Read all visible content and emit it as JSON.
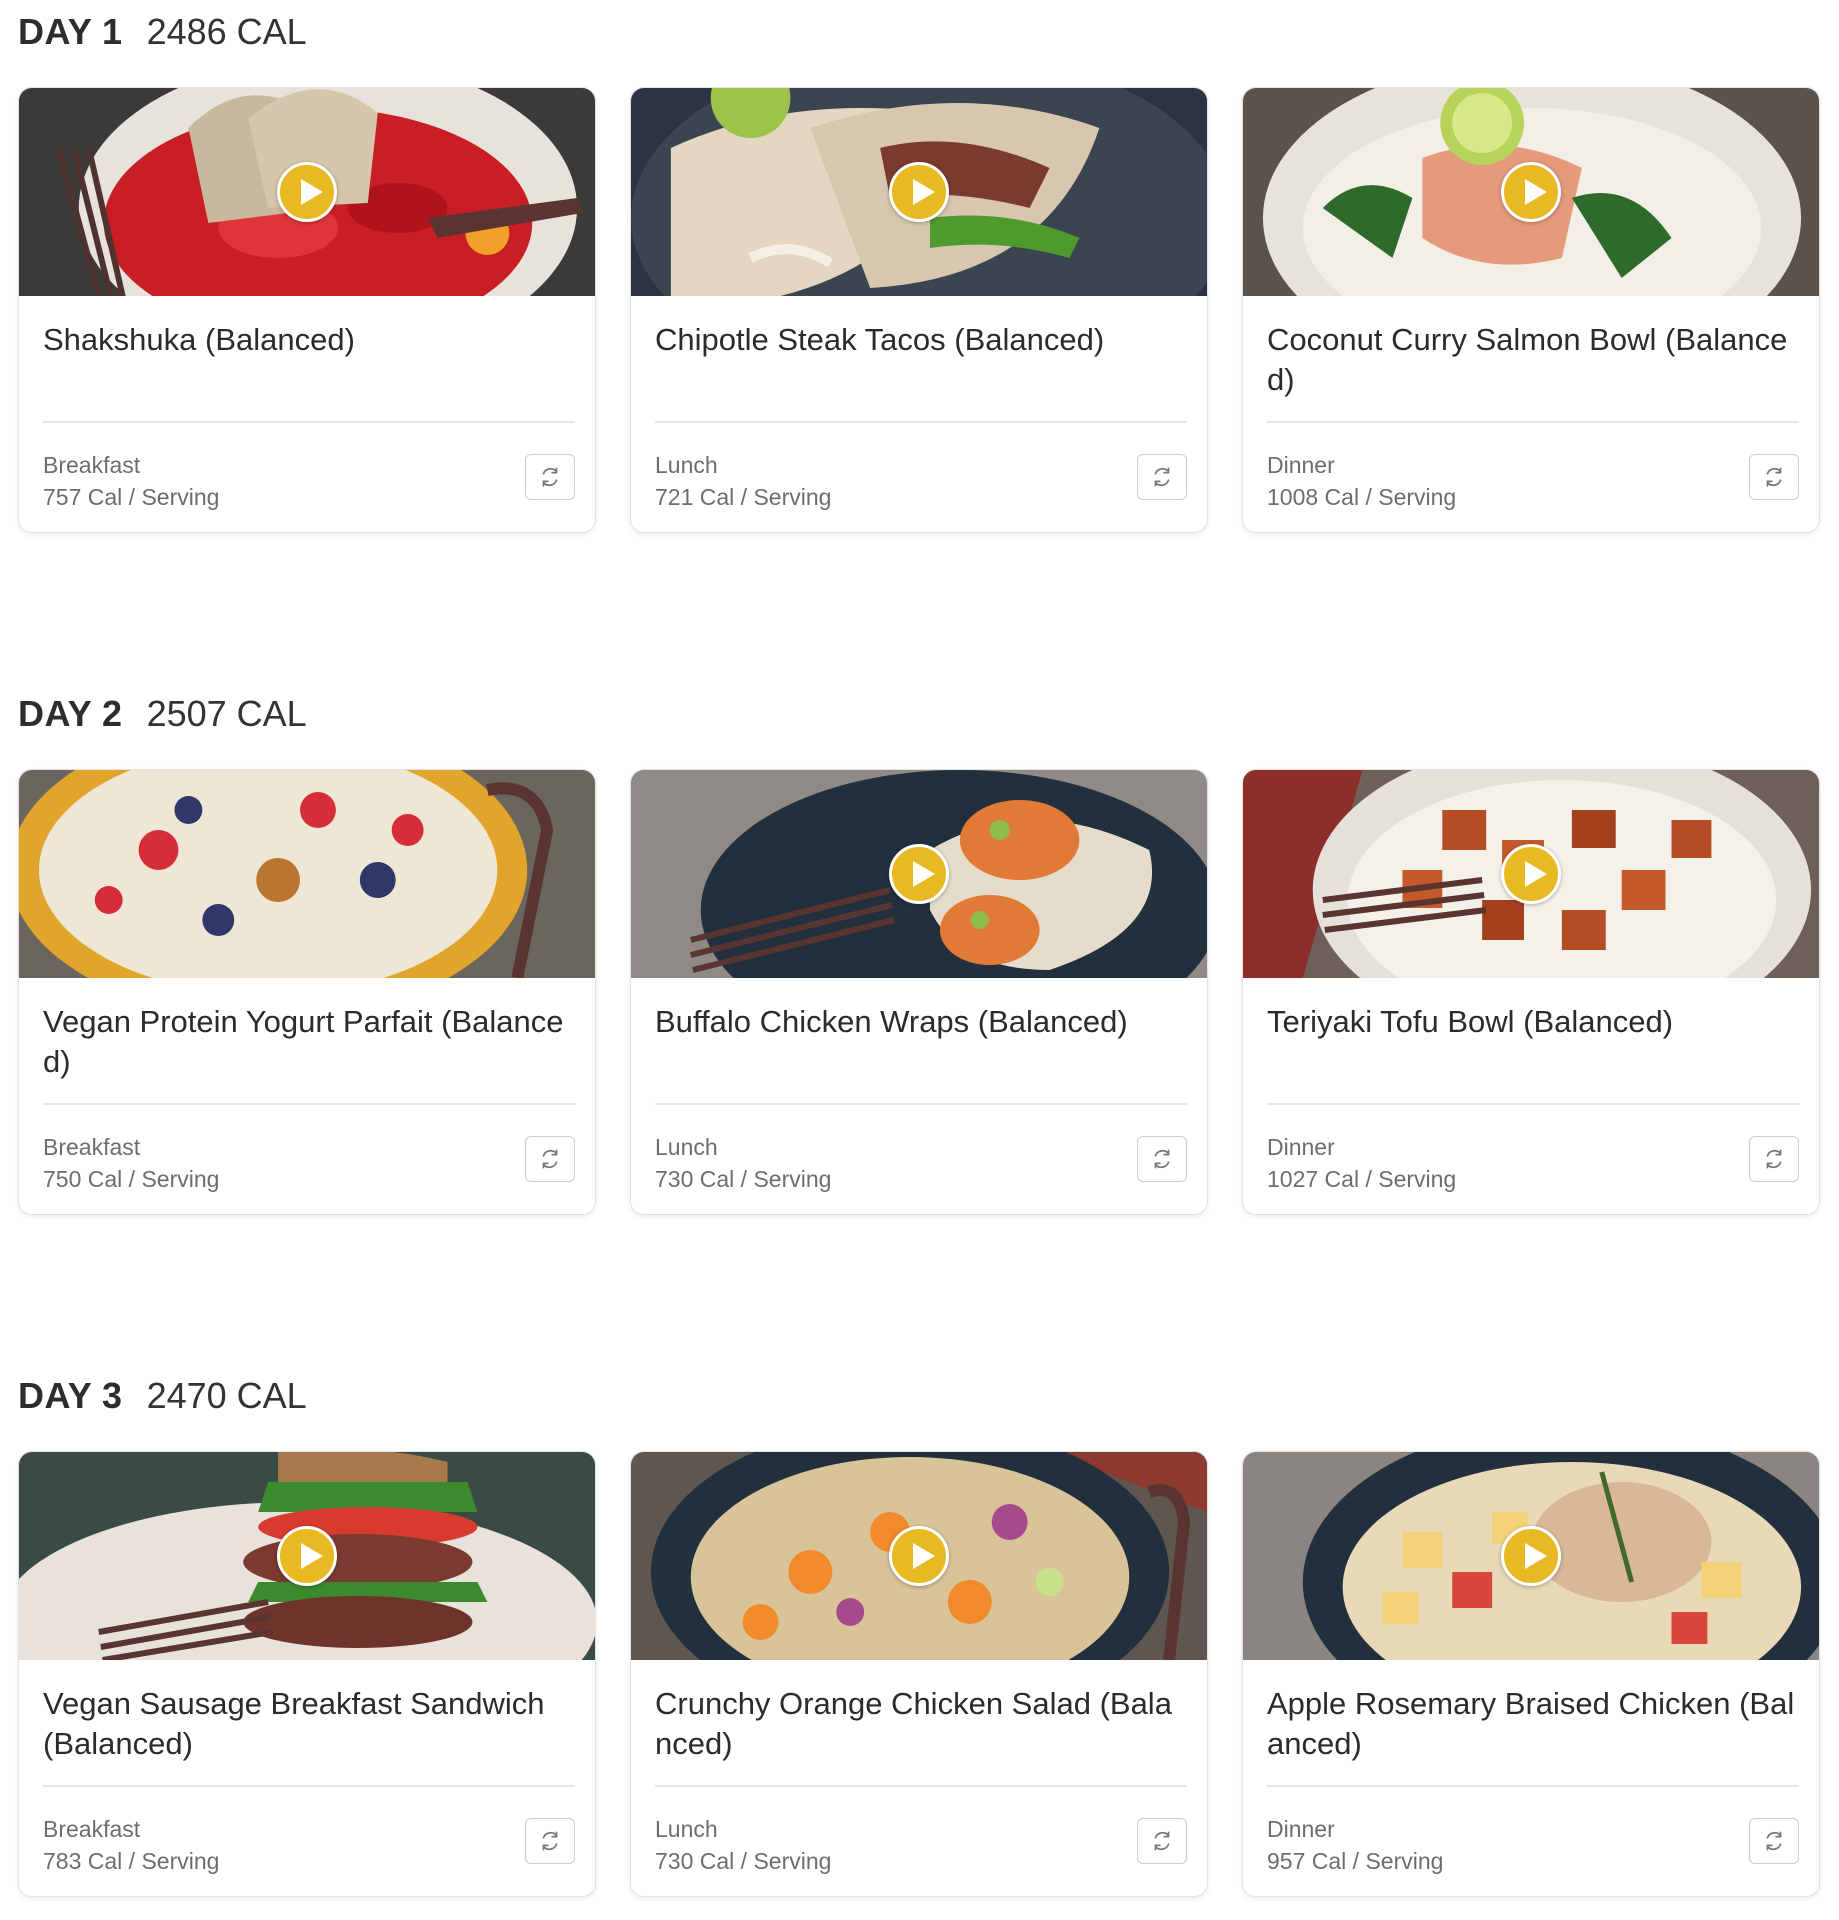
{
  "days": [
    {
      "label": "DAY 1",
      "calories": "2486 CAL",
      "meals": [
        {
          "title": "Shakshuka (Balanced)",
          "meal": "Breakfast",
          "cal": "757 Cal / Serving",
          "photo": "shakshuka"
        },
        {
          "title": "Chipotle Steak Tacos (Balanced)",
          "meal": "Lunch",
          "cal": "721 Cal / Serving",
          "photo": "steak-tacos"
        },
        {
          "title": "Coconut Curry Salmon Bowl (Balanced)",
          "meal": "Dinner",
          "cal": "1008 Cal / Serving",
          "photo": "salmon-bowl"
        }
      ]
    },
    {
      "label": "DAY 2",
      "calories": "2507 CAL",
      "meals": [
        {
          "title": "Vegan Protein Yogurt Parfait (Balanced)",
          "meal": "Breakfast",
          "cal": "750 Cal / Serving",
          "photo": "yogurt-parfait"
        },
        {
          "title": "Buffalo Chicken Wraps (Balanced)",
          "meal": "Lunch",
          "cal": "730 Cal / Serving",
          "photo": "chicken-wraps"
        },
        {
          "title": "Teriyaki Tofu Bowl (Balanced)",
          "meal": "Dinner",
          "cal": "1027 Cal / Serving",
          "photo": "tofu-bowl"
        }
      ]
    },
    {
      "label": "DAY 3",
      "calories": "2470 CAL",
      "meals": [
        {
          "title": "Vegan Sausage Breakfast Sandwich (Balanced)",
          "meal": "Breakfast",
          "cal": "783 Cal / Serving",
          "photo": "breakfast-sandwich"
        },
        {
          "title": "Crunchy Orange Chicken Salad (Balanced)",
          "meal": "Lunch",
          "cal": "730 Cal / Serving",
          "photo": "chicken-salad"
        },
        {
          "title": "Apple Rosemary Braised Chicken (Balanced)",
          "meal": "Dinner",
          "cal": "957 Cal / Serving",
          "photo": "braised-chicken"
        }
      ]
    }
  ],
  "icons": {
    "play": "play-icon",
    "swap": "swap-icon"
  },
  "colors": {
    "play_button": "#e8b923",
    "text": "#2b2b2b",
    "muted": "#6d6d6d",
    "border": "#e2e2e2"
  }
}
